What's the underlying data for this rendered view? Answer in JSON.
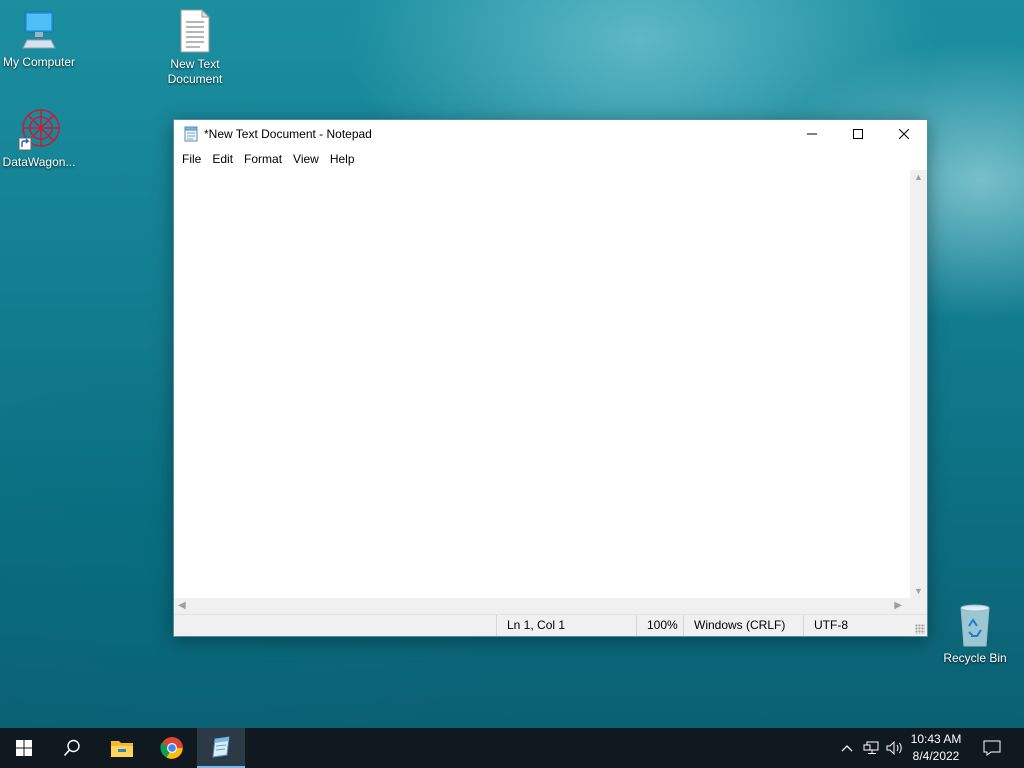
{
  "desktop": {
    "icons": [
      {
        "label": "My Computer",
        "icon": "monitor-icon"
      },
      {
        "label": "New Text\nDocument",
        "icon": "text-document-icon"
      },
      {
        "label": "DataWagon...",
        "icon": "datawagon-shortcut-icon"
      },
      {
        "label": "Recycle Bin",
        "icon": "recycle-bin-icon"
      }
    ]
  },
  "notepad": {
    "title": "*New Text Document - Notepad",
    "menu": [
      "File",
      "Edit",
      "Format",
      "View",
      "Help"
    ],
    "content": "",
    "status": {
      "position": "Ln 1, Col 1",
      "zoom": "100%",
      "line_ending": "Windows (CRLF)",
      "encoding": "UTF-8"
    }
  },
  "taskbar": {
    "items": [
      "start-icon",
      "search-icon",
      "file-explorer-icon",
      "chrome-icon",
      "notepad-icon"
    ],
    "active": "notepad-icon",
    "clock": {
      "time": "10:43 AM",
      "date": "8/4/2022"
    }
  },
  "colors": {
    "accent": "#76b9ed",
    "taskbar": "#101820",
    "wallpaper": "#137f92"
  }
}
